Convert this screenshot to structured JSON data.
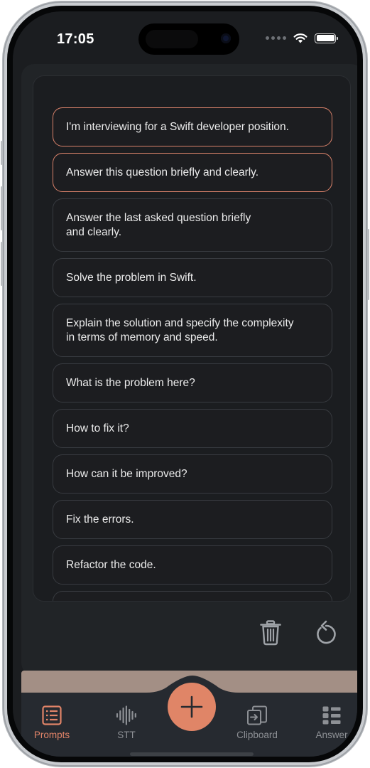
{
  "status_bar": {
    "time": "17:05"
  },
  "prompts": [
    {
      "text": "I'm interviewing for a Swift developer position.",
      "selected": true
    },
    {
      "text": "Answer this question briefly and clearly.",
      "selected": true
    },
    {
      "text": "Answer the last asked question briefly\nand clearly.",
      "selected": false
    },
    {
      "text": "Solve the problem in Swift.",
      "selected": false
    },
    {
      "text": "Explain the solution and specify the complexity\nin terms of memory and speed.",
      "selected": false
    },
    {
      "text": "What is the problem here?",
      "selected": false
    },
    {
      "text": "How to fix it?",
      "selected": false
    },
    {
      "text": "How can it be improved?",
      "selected": false
    },
    {
      "text": "Fix the errors.",
      "selected": false
    },
    {
      "text": "Refactor the code.",
      "selected": false
    }
  ],
  "actions": {
    "delete_icon": "trash-icon",
    "reset_icon": "reset-arrow-icon"
  },
  "tabs": [
    {
      "label": "Prompts",
      "icon": "prompts-list-icon",
      "active": true
    },
    {
      "label": "STT",
      "icon": "waveform-icon",
      "active": false
    },
    {
      "label": "Clipboard",
      "icon": "clipboard-paste-icon",
      "active": false
    },
    {
      "label": "Answer",
      "icon": "answer-list-icon",
      "active": false
    }
  ],
  "colors": {
    "accent": "#e08567",
    "inactive_tab": "#8d9095",
    "background": "#1b1d20"
  }
}
